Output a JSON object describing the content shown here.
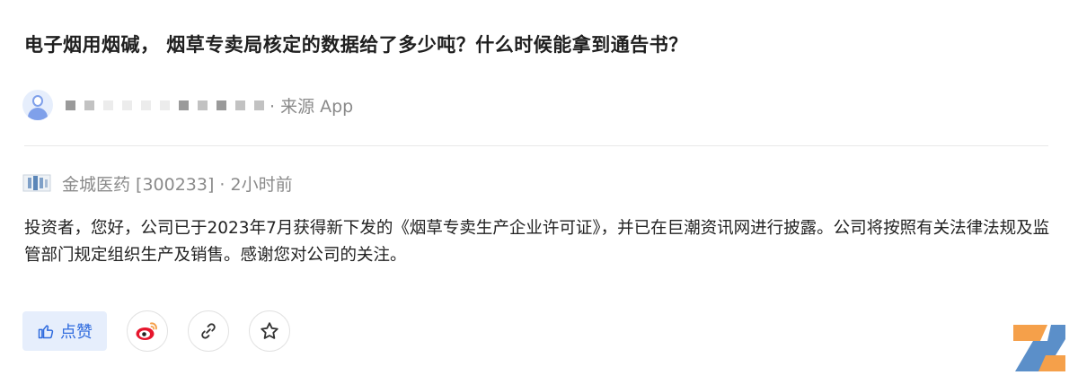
{
  "question": {
    "title": "电子烟用烟碱， 烟草专卖局核定的数据给了多少吨？什么时候能拿到通告书？"
  },
  "asker": {
    "source": "· 来源 App"
  },
  "answer": {
    "company": "金城医药 [300233] · 2小时前",
    "text": "投资者，您好，公司已于2023年7月获得新下发的《烟草专卖生产企业许可证》，并已在巨潮资讯网进行披露。公司将按照有关法律法规及监管部门规定组织生产及销售。感谢您对公司的关注。"
  },
  "actions": {
    "like_label": "点赞",
    "icons": [
      "thumb-up-icon",
      "weibo-icon",
      "link-icon",
      "star-icon"
    ]
  },
  "colors": {
    "accent": "#2f6bde",
    "accent_bg": "#e6eefc",
    "muted_text": "#8a8a8a",
    "body_text": "#222222",
    "weibo_red": "#e6162d",
    "brand_orange": "#f5a04a",
    "brand_blue": "#5b8fc9"
  }
}
